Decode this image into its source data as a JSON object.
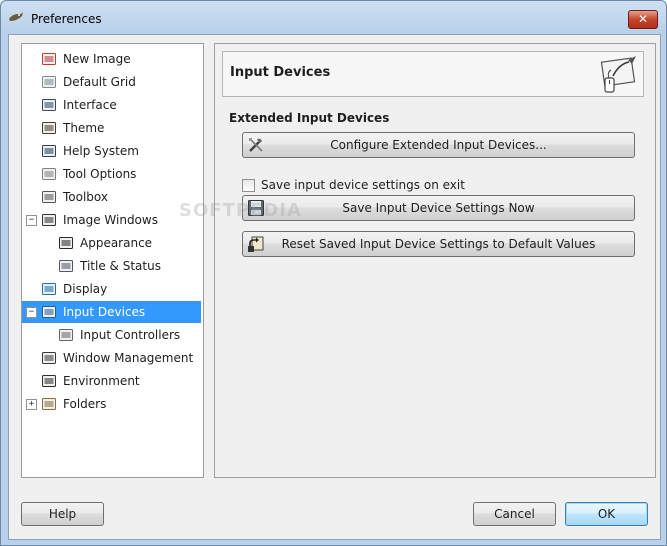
{
  "window": {
    "title": "Preferences",
    "close_label": "✕"
  },
  "sidebar": {
    "items": [
      {
        "label": "New Image",
        "icon": "new-image-icon"
      },
      {
        "label": "Default Grid",
        "icon": "grid-icon"
      },
      {
        "label": "Interface",
        "icon": "interface-icon"
      },
      {
        "label": "Theme",
        "icon": "theme-icon"
      },
      {
        "label": "Help System",
        "icon": "help-system-icon"
      },
      {
        "label": "Tool Options",
        "icon": "tool-options-icon"
      },
      {
        "label": "Toolbox",
        "icon": "toolbox-icon"
      },
      {
        "label": "Image Windows",
        "icon": "image-windows-icon",
        "expander": "−"
      },
      {
        "label": "Appearance",
        "icon": "appearance-icon"
      },
      {
        "label": "Title & Status",
        "icon": "title-status-icon"
      },
      {
        "label": "Display",
        "icon": "display-icon"
      },
      {
        "label": "Input Devices",
        "icon": "input-devices-icon",
        "expander": "−",
        "selected": true
      },
      {
        "label": "Input Controllers",
        "icon": "input-controllers-icon"
      },
      {
        "label": "Window Management",
        "icon": "window-management-icon"
      },
      {
        "label": "Environment",
        "icon": "environment-icon"
      },
      {
        "label": "Folders",
        "icon": "folders-icon",
        "expander": "+"
      }
    ]
  },
  "main": {
    "page_title": "Input Devices",
    "section_title": "Extended Input Devices",
    "configure_button": "Configure Extended Input Devices...",
    "save_on_exit_label": "Save input device settings on exit",
    "save_on_exit_checked": false,
    "save_now_button": "Save Input Device Settings Now",
    "reset_button": "Reset Saved Input Device Settings to Default Values"
  },
  "watermark": "SOFTPEDIA",
  "footer": {
    "help_label": "Help",
    "cancel_label": "Cancel",
    "ok_label": "OK"
  },
  "colors": {
    "selection": "#3399ff",
    "window_frame": "#b9d1ea",
    "close_button": "#c7432c"
  }
}
